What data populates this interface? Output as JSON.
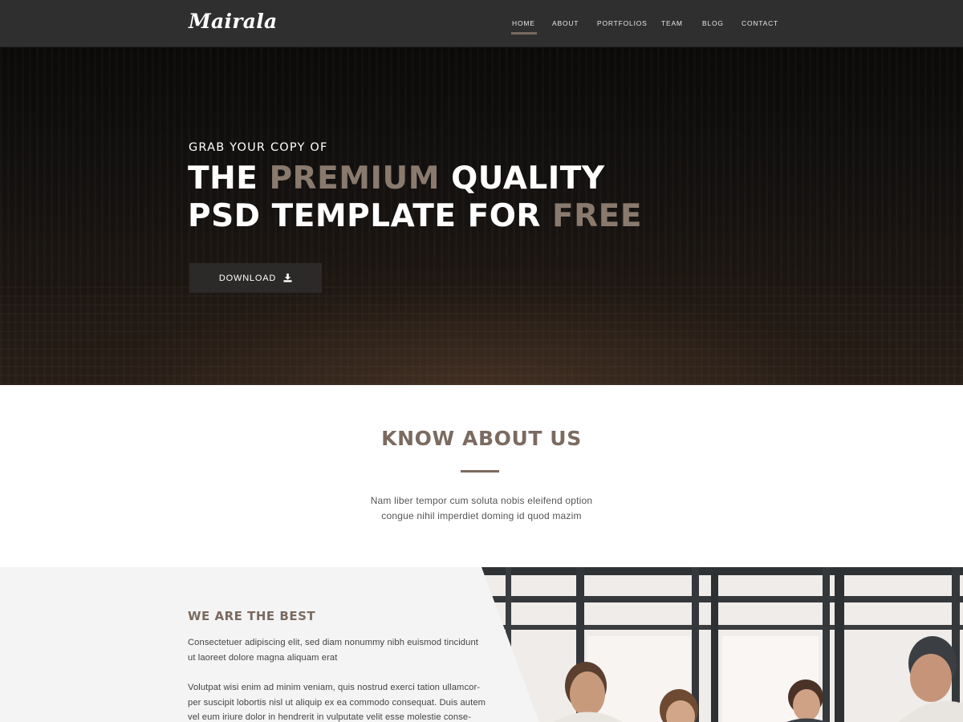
{
  "nav": {
    "logo": "Mairala",
    "items": [
      {
        "label": "HOME",
        "active": true
      },
      {
        "label": "ABOUT",
        "active": false
      },
      {
        "label": "PORTFOLIOS",
        "active": false
      },
      {
        "label": "TEAM",
        "active": false
      },
      {
        "label": "BLOG",
        "active": false
      },
      {
        "label": "CONTACT",
        "active": false
      }
    ]
  },
  "hero": {
    "kicker": "GRAB YOUR COPY OF",
    "line1_a": "THE ",
    "line1_accent": "PREMIUM",
    "line1_b": " QUALITY",
    "line2_a": "PSD TEMPLATE FOR ",
    "line2_accent": "FREE",
    "button_label": "DOWNLOAD",
    "button_icon": "download-icon"
  },
  "about": {
    "title": "KNOW ABOUT US",
    "text_line1": "Nam liber tempor cum soluta nobis eleifend option",
    "text_line2": "congue nihil imperdiet doming id quod mazim"
  },
  "best": {
    "title": "WE ARE THE BEST",
    "para1_line1": "Consectetuer adipiscing elit, sed diam nonummy nibh euismod tincidunt",
    "para1_line2": "ut laoreet dolore magna aliquam erat",
    "para2_line1": "Volutpat wisi enim ad minim veniam, quis nostrud exerci tation ullamcor-",
    "para2_line2": "per suscipit lobortis nisl ut aliquip ex ea commodo consequat. Duis autem",
    "para2_line3": "vel eum iriure dolor in hendrerit in vulputate velit esse molestie conse-"
  },
  "colors": {
    "accent": "#7b6a60",
    "nav_bg": "#2f2f2f",
    "button_bg": "#2c2a29",
    "section_bg": "#f4f4f4"
  }
}
